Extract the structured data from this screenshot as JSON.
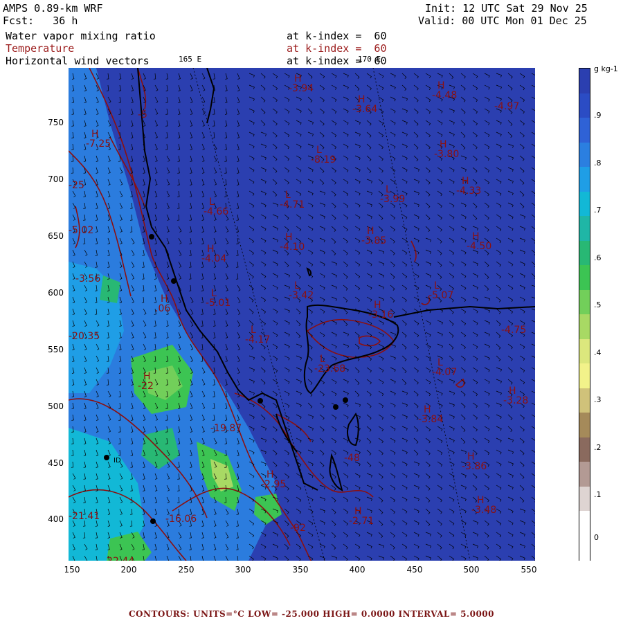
{
  "header": {
    "model": "AMPS 0.89-km WRF",
    "forecast": "Fcst:   36 h",
    "init": "Init: 12 UTC Sat 29 Nov 25",
    "valid": "Valid: 00 UTC Mon 01 Dec 25"
  },
  "fields": [
    {
      "name": "Water vapor mixing ratio",
      "level": "at k-index =  60",
      "color": "#000000"
    },
    {
      "name": "Temperature",
      "level": "at k-index =  60",
      "color": "#9b1b1b"
    },
    {
      "name": "Horizontal wind vectors",
      "level": "at k-index =  60",
      "color": "#000000"
    }
  ],
  "longitude_labels": [
    "165 E",
    "170 E"
  ],
  "y_ticks": [
    "750",
    "700",
    "650",
    "600",
    "550",
    "500",
    "450",
    "400"
  ],
  "x_ticks": [
    "150",
    "200",
    "250",
    "300",
    "350",
    "400",
    "450",
    "500",
    "550"
  ],
  "colorbar": {
    "unit": "g kg-1",
    "labels": [
      ".9",
      ".8",
      ".7",
      ".6",
      ".5",
      ".4",
      ".3",
      ".2",
      ".1",
      "0"
    ],
    "colors": [
      "#2b3fb0",
      "#2b4cc4",
      "#2f62d6",
      "#2b7fe0",
      "#1f9ee6",
      "#12b8d6",
      "#1fb6a6",
      "#28b874",
      "#3cc453",
      "#72cf5a",
      "#a8d964",
      "#dce77d",
      "#f2f28a",
      "#d0c27a",
      "#a58a5a",
      "#8a6a5e",
      "#b39a94",
      "#ded4d2",
      "#ffffff",
      "#ffffff"
    ],
    "max": 1.0,
    "min": 0.0
  },
  "temperature_labels": [
    {
      "marker": "H",
      "value": "-3.94"
    },
    {
      "marker": "H",
      "value": "-3.64"
    },
    {
      "marker": "H",
      "value": "-4.48"
    },
    {
      "marker": "",
      "value": "-4.97"
    },
    {
      "marker": "H",
      "value": "-7.25"
    },
    {
      "marker": "L",
      "value": "-8.19"
    },
    {
      "marker": "H",
      "value": "-3.80"
    },
    {
      "marker": "L",
      "value": "-4.66"
    },
    {
      "marker": "L",
      "value": "-4.71"
    },
    {
      "marker": "L",
      "value": "-3.99"
    },
    {
      "marker": "H",
      "value": "-4.33"
    },
    {
      "marker": "H",
      "value": "-4.04"
    },
    {
      "marker": "H",
      "value": "-4.10"
    },
    {
      "marker": "H",
      "value": "-3.85"
    },
    {
      "marker": "H",
      "value": "-4.50"
    },
    {
      "marker": "L",
      "value": "-3.42"
    },
    {
      "marker": "L",
      "value": "-5.07"
    },
    {
      "marker": "L",
      "value": "-5.01"
    },
    {
      "marker": "H",
      "value": "-3.16"
    },
    {
      "marker": "",
      "value": "-4.75"
    },
    {
      "marker": "L",
      "value": "-4.17"
    },
    {
      "marker": "L",
      "value": "-4.07"
    },
    {
      "marker": "L",
      "value": "-23.68"
    },
    {
      "marker": "H",
      "value": "-3.28"
    },
    {
      "marker": "H",
      "value": "-3.84"
    },
    {
      "marker": "",
      "value": "-19.87"
    },
    {
      "marker": "",
      "value": "-48"
    },
    {
      "marker": "H",
      "value": "-3.86"
    },
    {
      "marker": "H",
      "value": "-2.95"
    },
    {
      "marker": "H",
      "value": "-3.48"
    },
    {
      "marker": "H",
      "value": "-2.71"
    },
    {
      "marker": "",
      "value": "-92"
    },
    {
      "marker": "",
      "value": "-21.41"
    },
    {
      "marker": "",
      "value": "-16.06"
    },
    {
      "marker": "",
      "value": "-22.44"
    },
    {
      "marker": "",
      "value": "-3.56"
    },
    {
      "marker": "",
      "value": "-5.02"
    },
    {
      "marker": "",
      "value": "-20.35"
    },
    {
      "marker": "H",
      "value": ".06"
    },
    {
      "marker": "",
      "value": "-5"
    },
    {
      "marker": "",
      "value": "-25"
    },
    {
      "marker": "H",
      "value": "-22"
    }
  ],
  "station_label": "ID",
  "footer": "CONTOURS:  UNITS=°C  LOW= -25.000      HIGH=  0.0000      INTERVAL=   5.0000"
}
